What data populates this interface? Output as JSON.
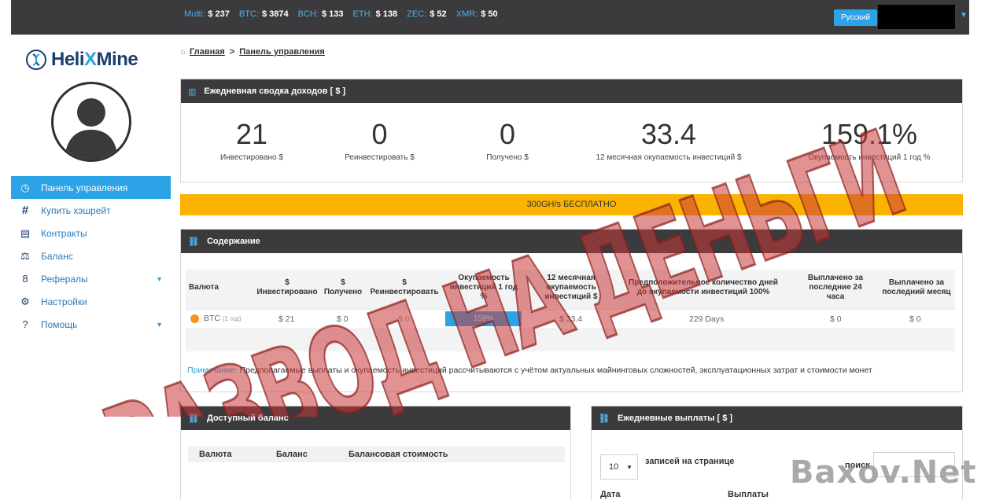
{
  "topbar": {
    "prices": [
      {
        "ticker": "Multi:",
        "value": "$ 237"
      },
      {
        "ticker": "BTC:",
        "value": "$ 3874"
      },
      {
        "ticker": "BCH:",
        "value": "$ 133"
      },
      {
        "ticker": "ETH:",
        "value": "$ 138"
      },
      {
        "ticker": "ZEC:",
        "value": "$ 52"
      },
      {
        "ticker": "XMR:",
        "value": "$ 50"
      }
    ],
    "language": "Русский"
  },
  "logo": {
    "part1": "Heli",
    "part2": "X",
    "part3": "Mine"
  },
  "sidebar": {
    "items": [
      {
        "label": "Панель управления",
        "icon": "dashboard-icon"
      },
      {
        "label": "Купить хэшрейт",
        "icon": "hash-icon"
      },
      {
        "label": "Контракты",
        "icon": "contract-icon"
      },
      {
        "label": "Баланс",
        "icon": "scales-icon"
      },
      {
        "label": "Рефералы",
        "icon": "referral-icon"
      },
      {
        "label": "Настройки",
        "icon": "gear-icon"
      },
      {
        "label": "Помощь",
        "icon": "help-icon"
      }
    ]
  },
  "breadcrumb": {
    "home": "Главная",
    "current": "Панель управления"
  },
  "summary": {
    "title": "Ежедневная сводка доходов [ $ ]",
    "stats": [
      {
        "value": "21",
        "label": "Инвестировано $"
      },
      {
        "value": "0",
        "label": "Реинвестировать $"
      },
      {
        "value": "0",
        "label": "Получено $"
      },
      {
        "value": "33.4",
        "label": "12 месячная окупаемость инвестиций $"
      },
      {
        "value": "159.1%",
        "label": "Окупаемость инвестиций 1 год %"
      }
    ]
  },
  "promo": "300GH/s БЕСПЛАТНО",
  "content": {
    "title": "Содержание",
    "headers": {
      "currency": "Валюта",
      "invested_sym": "$",
      "invested": "Инвестировано",
      "received_sym": "$",
      "received": "Получено",
      "reinvest_sym": "$",
      "reinvest": "Реинвестировать",
      "roi_year_1": "Окупаемость",
      "roi_year_2": "инвестиций 1 год",
      "roi_year_3": "%",
      "roi12_1": "12 месячная",
      "roi12_2": "окупаемость",
      "roi12_3": "инвестиций $",
      "days_1": "Предположительное количество дней",
      "days_2": "до окупаемости инвестиций 100%",
      "paid24_1": "Выплачено за",
      "paid24_2": "последние 24",
      "paid24_3": "часа",
      "paidm_1": "Выплачено за",
      "paidm_2": "последний месяц"
    },
    "row": {
      "currency": "BTC",
      "currency_sub": "(1 год)",
      "invested": "$ 21",
      "received": "$ 0",
      "reinvest": "$ 0",
      "roi_year": "159%",
      "roi12": "$ 33.4",
      "days": "229 Days",
      "paid24": "$ 0",
      "paid_month": "$ 0"
    },
    "note_label": "Примечание:",
    "note_text": "Предполагаемые выплаты и окупаемость инвестиций рассчитываются с учётом актуальных майнинговых сложностей, эксплуатационных затрат и стоимости монет"
  },
  "balance": {
    "title": "Доступный баланс",
    "columns": [
      "Валюта",
      "Баланс",
      "Балансовая стоимость"
    ]
  },
  "payouts": {
    "title": "Ежедневные выплаты [ $ ]",
    "per_page_value": "10",
    "per_page_label": "записей на странице",
    "search_label": "поиск",
    "columns": [
      "Дата",
      "Выплаты"
    ]
  },
  "overlay": {
    "stamp_text": "РАЗВОД НА ДЕНЬГИ",
    "watermark": "Baxov.Net",
    "stamp_color": "#c93a3a"
  }
}
